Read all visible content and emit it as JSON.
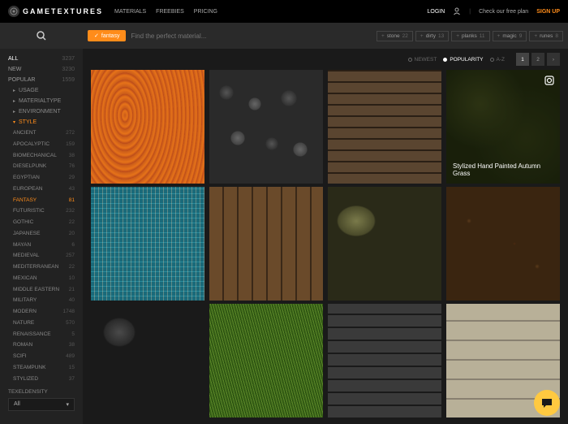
{
  "brand": "GAMETEXTURES",
  "nav": {
    "materials": "MATERIALS",
    "freebies": "FREEBIES",
    "pricing": "PRICING"
  },
  "header": {
    "login": "LOGIN",
    "freeplan": "Check our free plan",
    "signup": "SIGN UP"
  },
  "sidebar": {
    "all": {
      "label": "ALL",
      "count": "3237"
    },
    "new": {
      "label": "NEW",
      "count": "3230"
    },
    "popular": {
      "label": "POPULAR",
      "count": "1559"
    },
    "cats": {
      "usage": "USAGE",
      "materialtype": "MATERIALTYPE",
      "environment": "ENVIRONMENT",
      "style": "STYLE"
    },
    "styles": [
      {
        "label": "ANCIENT",
        "count": "272"
      },
      {
        "label": "APOCALYPTIC",
        "count": "159"
      },
      {
        "label": "BIOMECHANICAL",
        "count": "38"
      },
      {
        "label": "DIESELPUNK",
        "count": "76"
      },
      {
        "label": "EGYPTIAN",
        "count": "29"
      },
      {
        "label": "EUROPEAN",
        "count": "43"
      },
      {
        "label": "FANTASY",
        "count": "81"
      },
      {
        "label": "FUTURISTIC",
        "count": "232"
      },
      {
        "label": "GOTHIC",
        "count": "22"
      },
      {
        "label": "JAPANESE",
        "count": "20"
      },
      {
        "label": "MAYAN",
        "count": "6"
      },
      {
        "label": "MEDIEVAL",
        "count": "257"
      },
      {
        "label": "MEDITERRANEAN",
        "count": "22"
      },
      {
        "label": "MEXICAN",
        "count": "10"
      },
      {
        "label": "MIDDLE EASTERN",
        "count": "21"
      },
      {
        "label": "MILITARY",
        "count": "40"
      },
      {
        "label": "MODERN",
        "count": "1748"
      },
      {
        "label": "NATURE",
        "count": "570"
      },
      {
        "label": "RENAISSANCE",
        "count": "5"
      },
      {
        "label": "ROMAN",
        "count": "38"
      },
      {
        "label": "SCIFI",
        "count": "489"
      },
      {
        "label": "STEAMPUNK",
        "count": "15"
      },
      {
        "label": "STYLIZED",
        "count": "37"
      }
    ],
    "texel": {
      "label": "TEXELDENSITY",
      "value": "All"
    }
  },
  "filter": {
    "active_tag": "fantasy",
    "placeholder": "Find the perfect material...",
    "suggestions": [
      {
        "label": "stone",
        "count": "22"
      },
      {
        "label": "dirty",
        "count": "13"
      },
      {
        "label": "planks",
        "count": "11"
      },
      {
        "label": "magic",
        "count": "9"
      },
      {
        "label": "runes",
        "count": "8"
      }
    ]
  },
  "sort": {
    "newest": "NEWEST",
    "popularity": "POPULARITY",
    "az": "A-Z"
  },
  "pages": {
    "p1": "1",
    "p2": "2",
    "next": "›"
  },
  "hover": {
    "title": "Stylized Hand Painted Autumn Grass"
  }
}
